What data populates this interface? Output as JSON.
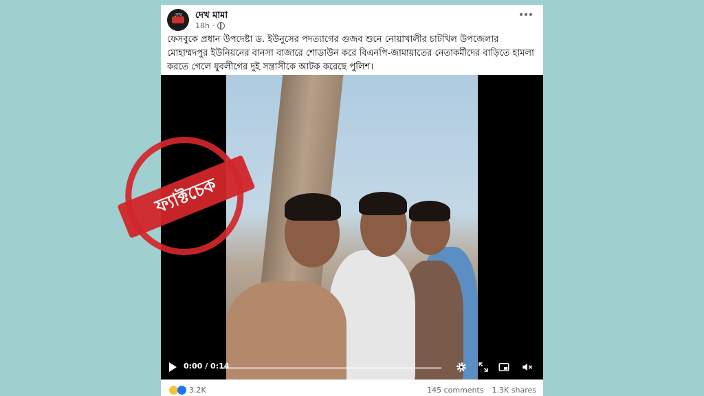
{
  "post": {
    "page_name": "দেখ মামা",
    "avatar_text": "দেখ",
    "time": "18h",
    "privacy_icon": "globe-icon",
    "text": "ফেসবুকে প্রধান উপদেষ্টা ড. ইউনুসের পদত্যাগের গুজব শুনে নোয়াখালীর চাটখিল উপজেলার মোহাম্মদপুর ইউনিয়নের বানসা বাজারে শোডাউন করে বিএনপি-জামায়াতের নেতাকর্মীদের বাড়িতে হামলা করতে গেলে যুবলীগের দুই সন্ত্রাসীকে  আটক করেছে পুলিশ।"
  },
  "video": {
    "time_display": "0:00 / 0:14",
    "progress": 0.0
  },
  "stamp": {
    "text": "ফ্যাক্টচেক",
    "color": "#d2262b"
  },
  "footer": {
    "reaction_count": "3.2K",
    "comments": "145 comments",
    "shares": "1.3K shares"
  },
  "colors": {
    "background": "#9fcfcf",
    "card": "#ffffff"
  }
}
